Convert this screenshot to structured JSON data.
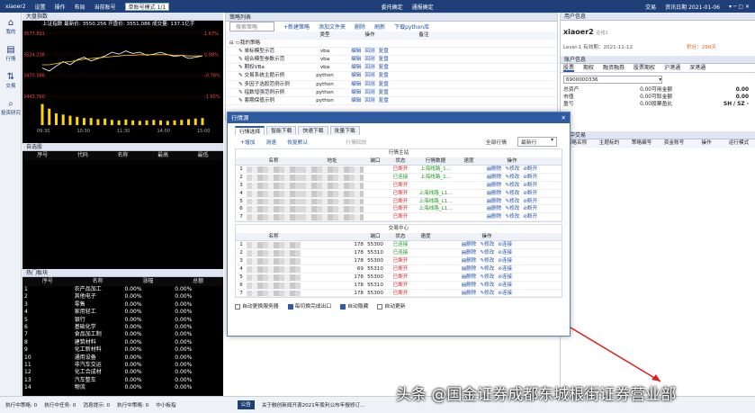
{
  "topbar": {
    "brand": "xiaoer2",
    "items": [
      "设置",
      "操作",
      "布局",
      "当前账号"
    ],
    "account_select": "单账号模式 1/1",
    "mid": [
      "委托确定",
      "通报确定"
    ],
    "right": [
      "交易",
      "资讯日期 2021-01-06"
    ]
  },
  "left_nav": [
    {
      "icon": "home-icon",
      "label": "我的"
    },
    {
      "icon": "chart-icon",
      "label": "行情"
    },
    {
      "icon": "trade-icon",
      "label": "交易"
    },
    {
      "icon": "search-icon",
      "label": "投资研究"
    }
  ],
  "chart_panel": {
    "title": "大盘指数",
    "info": "上证指数 最新价: 3550.256 开盘价: 3551.086 成交量: 137.1亿手",
    "y_left": [
      "3577.891",
      "3524.238",
      "3470.586",
      "3443.760"
    ],
    "y_right": [
      "1.67%",
      "0.08%",
      "-0.78%",
      "-1.65%"
    ],
    "x_ticks": [
      "09:30",
      "10:30",
      "11:30",
      "14:00",
      "15:00"
    ],
    "line_vals": [
      0.55,
      0.6,
      0.52,
      0.45,
      0.5,
      0.42,
      0.38,
      0.44,
      0.4,
      0.36,
      0.3,
      0.33,
      0.28,
      0.32,
      0.3,
      0.35,
      0.33,
      0.3,
      0.34,
      0.37,
      0.35,
      0.4,
      0.38,
      0.36
    ],
    "avg_vals": [
      0.5,
      0.5,
      0.48,
      0.46,
      0.45,
      0.43,
      0.41,
      0.4,
      0.39,
      0.38,
      0.37,
      0.36,
      0.35,
      0.35,
      0.34,
      0.34,
      0.34,
      0.34,
      0.34,
      0.35,
      0.35,
      0.36,
      0.36,
      0.36
    ],
    "vol_vals": [
      0.9,
      0.7,
      0.5,
      0.45,
      0.4,
      0.35,
      0.3,
      0.3,
      0.25,
      0.28,
      0.22,
      0.2,
      0.24,
      0.2,
      0.18,
      0.2,
      0.22,
      0.2,
      0.18,
      0.2,
      0.22,
      0.25,
      0.28,
      0.3
    ]
  },
  "watch_panel": {
    "title": "自选股",
    "headers": [
      "序号",
      "代码",
      "名称",
      "最高",
      "最低"
    ]
  },
  "hot_panel": {
    "title": "热门板块",
    "headers": [
      "序号",
      "名称",
      "涨幅",
      "总额"
    ],
    "rows": [
      [
        "1",
        "农产品加工",
        "0.00%",
        "0.00%"
      ],
      [
        "2",
        "其他电子",
        "0.00%",
        "0.00%"
      ],
      [
        "3",
        "零售",
        "0.00%",
        "0.00%"
      ],
      [
        "4",
        "家用轻工",
        "0.00%",
        "0.00%"
      ],
      [
        "5",
        "银行",
        "0.00%",
        "0.00%"
      ],
      [
        "6",
        "基础化学",
        "0.00%",
        "0.00%"
      ],
      [
        "7",
        "食品加工制",
        "0.00%",
        "0.00%"
      ],
      [
        "8",
        "建筑材料",
        "0.00%",
        "0.00%"
      ],
      [
        "9",
        "化工新材料",
        "0.00%",
        "0.00%"
      ],
      [
        "10",
        "通用设备",
        "0.00%",
        "0.00%"
      ],
      [
        "11",
        "非汽车交运",
        "0.00%",
        "0.00%"
      ],
      [
        "12",
        "化工合成材",
        "0.00%",
        "0.00%"
      ],
      [
        "13",
        "汽车整车",
        "0.00%",
        "0.00%"
      ],
      [
        "14",
        "物流",
        "0.00%",
        "0.00%"
      ]
    ]
  },
  "policy_panel": {
    "title": "策略列表",
    "search": "搜索策略",
    "toolbar": [
      "+新建策略",
      "添加文件夹",
      "删除",
      "刷新",
      "下载python库"
    ],
    "headers": [
      "",
      "类型",
      "操作",
      "备注"
    ],
    "root": "我的策略",
    "rows": [
      {
        "name": "单标模型示范",
        "type": "vba"
      },
      {
        "name": "组合模型参数示范",
        "type": "vba"
      },
      {
        "name": "期权VBa",
        "type": "vba"
      },
      {
        "name": "交易系统主题示例",
        "type": "python"
      },
      {
        "name": "多因子选股范例示例",
        "type": "python"
      },
      {
        "name": "指数增强范例示例",
        "type": "python"
      },
      {
        "name": "套期保值示例",
        "type": "python"
      }
    ],
    "ops": [
      "编辑",
      "回测",
      "复盘"
    ]
  },
  "user_panel": {
    "title": "用户信息",
    "name": "xiaoer2",
    "status": "在线1",
    "level": "Level-1 有效期：2021-11-12",
    "points": "积分：290天",
    "acct_title": "账户信息",
    "tabs": [
      "股票",
      "期权",
      "融资融券",
      "股票期权",
      "沪港通",
      "深港通"
    ],
    "account": "6900000336",
    "rows": [
      [
        "总资产",
        "0.00",
        "可用金额",
        "0.00"
      ],
      [
        "市值",
        "0.00",
        "可取金额",
        "0.00"
      ],
      [
        "盈亏",
        "0.00",
        "股票盈比",
        "SH / SZ -"
      ]
    ],
    "orders_title": "行中交易",
    "orders_headers": [
      "策略名称",
      "主题标的",
      "策略编号",
      "资金账号",
      "操作",
      "运行模式"
    ]
  },
  "dialog": {
    "title": "行情源",
    "tabs": [
      "行情选择",
      "智能下载",
      "快速下载",
      "批量下载"
    ],
    "toolbar": [
      "+增加",
      "测速",
      "恢复默认",
      "行情回放"
    ],
    "all_label": "全部行情",
    "all_value": "最新行",
    "section1": "行情主站",
    "headers1": [
      "",
      "名称",
      "地址",
      "端口",
      "状态",
      "行情数据",
      "速度",
      "操作"
    ],
    "rows1": [
      {
        "n": "1",
        "port": "",
        "status": "已断开",
        "data": "上海线路_1...",
        "sc": "red"
      },
      {
        "n": "2",
        "port": "",
        "status": "已连接",
        "data": "上海线路_1...",
        "sc": "green"
      },
      {
        "n": "3",
        "port": "",
        "status": "已断开",
        "data": "",
        "sc": "red"
      },
      {
        "n": "4",
        "port": "",
        "status": "已断开",
        "data": "上海线路_L1...",
        "sc": "red"
      },
      {
        "n": "5",
        "port": "",
        "status": "已断开",
        "data": "上海线路_L1...",
        "sc": "red"
      },
      {
        "n": "6",
        "port": "",
        "status": "已断开",
        "data": "上海线路_L1...",
        "sc": "red"
      },
      {
        "n": "7",
        "port": "",
        "status": "已断开",
        "data": "",
        "sc": "red"
      }
    ],
    "section2": "交易中心",
    "headers2": [
      "",
      "名称",
      "",
      "端口",
      "状态",
      "速度",
      "操作"
    ],
    "rows2": [
      {
        "n": "1",
        "ip": "178",
        "port": "55300",
        "status": "已连接",
        "sc": "green"
      },
      {
        "n": "2",
        "ip": "178",
        "port": "55310",
        "status": "已连接",
        "sc": "green"
      },
      {
        "n": "3",
        "ip": "178",
        "port": "55300",
        "status": "已断开",
        "sc": "red"
      },
      {
        "n": "4",
        "ip": "69",
        "port": "55310",
        "status": "已断开",
        "sc": "red"
      },
      {
        "n": "5",
        "ip": "178",
        "port": "55300",
        "status": "已断开",
        "sc": "red"
      },
      {
        "n": "6",
        "ip": "178",
        "port": "55310",
        "status": "已断开",
        "sc": "red"
      },
      {
        "n": "7",
        "ip": "178",
        "port": "55300",
        "status": "已断开",
        "sc": "red"
      }
    ],
    "ops1": [
      "删除",
      "修改",
      "断开"
    ],
    "ops2": [
      "删除",
      "修改",
      "连接"
    ],
    "checks": [
      {
        "label": "自动更换服务器",
        "on": false
      },
      {
        "label": "每切换完成出口",
        "on": true
      },
      {
        "label": "自动隐藏",
        "on": true
      },
      {
        "label": "自动更新",
        "on": false
      }
    ]
  },
  "statusbar": {
    "items": [
      "执行中策略: 0",
      "执行中任务: 0",
      "消息提示: 0",
      "执行中策略: 0",
      "中小板指"
    ],
    "ticker": "公告",
    "notice": "关于融创新闻开源2021年股利公布年报修订..."
  },
  "watermark": "头条 @国金证券成都东城根街证券营业部"
}
